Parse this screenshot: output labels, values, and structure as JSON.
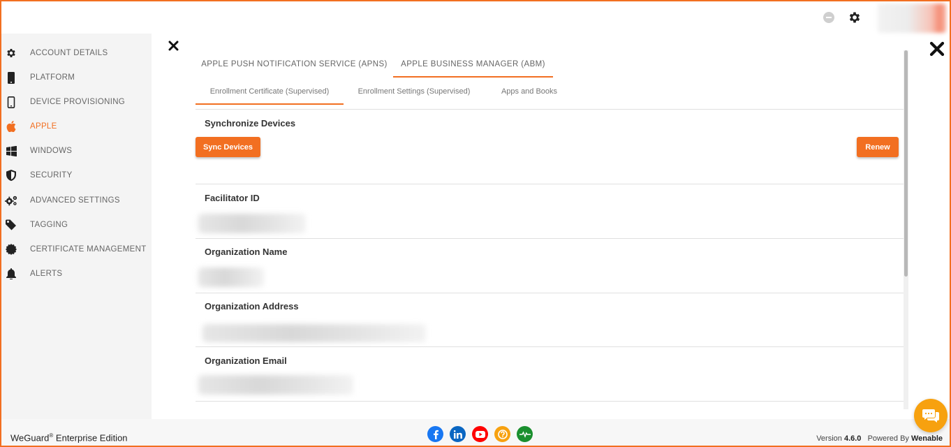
{
  "topbar": {
    "status_icon": "minus-circle-icon",
    "settings_icon": "gear-icon"
  },
  "sidebar": {
    "items": [
      {
        "label": "ACCOUNT DETAILS",
        "icon": "gear-icon"
      },
      {
        "label": "PLATFORM",
        "icon": "phone-icon"
      },
      {
        "label": "DEVICE PROVISIONING",
        "icon": "mobile-outline-icon"
      },
      {
        "label": "APPLE",
        "icon": "apple-icon",
        "active": true
      },
      {
        "label": "WINDOWS",
        "icon": "windows-icon"
      },
      {
        "label": "SECURITY",
        "icon": "shield-icon"
      },
      {
        "label": "ADVANCED SETTINGS",
        "icon": "gears-icon"
      },
      {
        "label": "TAGGING",
        "icon": "tag-icon"
      },
      {
        "label": "CERTIFICATE MANAGEMENT",
        "icon": "certificate-icon"
      },
      {
        "label": "ALERTS",
        "icon": "bell-icon"
      }
    ]
  },
  "tabs": [
    {
      "label": "APPLE PUSH NOTIFICATION SERVICE (APNS)"
    },
    {
      "label": "APPLE BUSINESS MANAGER (ABM)",
      "active": true
    }
  ],
  "subtabs": [
    {
      "label": "Enrollment Certificate (Supervised)",
      "active": true
    },
    {
      "label": "Enrollment Settings (Supervised)"
    },
    {
      "label": "Apps and Books"
    }
  ],
  "sync": {
    "title": "Synchronize Devices",
    "sync_button": "Sync Devices",
    "renew_button": "Renew"
  },
  "fields": [
    {
      "label": "Facilitator ID"
    },
    {
      "label": "Organization Name"
    },
    {
      "label": "Organization Address"
    },
    {
      "label": "Organization Email"
    }
  ],
  "footer": {
    "brand": "WeGuard",
    "brand_reg": "®",
    "edition": " Enterprise Edition",
    "version_label": "Version ",
    "version": "4.6.0",
    "powered_label": "Powered By ",
    "powered_by": "Wenable",
    "social": [
      {
        "icon": "facebook-icon",
        "color": "#1877f2"
      },
      {
        "icon": "linkedin-icon",
        "color": "#0a66c2"
      },
      {
        "icon": "youtube-icon",
        "color": "#ff0000"
      },
      {
        "icon": "help-icon",
        "color": "#f7a10f"
      },
      {
        "icon": "activity-icon",
        "color": "#1a8f2e"
      }
    ]
  },
  "colors": {
    "accent": "#f26f21",
    "chat": "#f7a10f"
  },
  "chat_icon": "chat-icon"
}
